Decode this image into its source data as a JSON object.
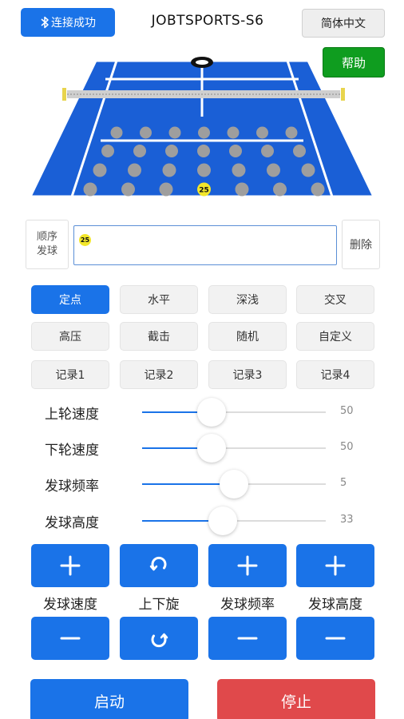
{
  "header": {
    "connect_label": "连接成功",
    "title": "JOBTSPORTS-S6",
    "language_label": "简体中文",
    "help_label": "帮助"
  },
  "court": {
    "selected_label": "25",
    "colors": {
      "court": "#1a5fd6",
      "lines": "#ffffff",
      "net": "#c8c8c8",
      "dots": "#9e9e9e",
      "selected": "#f2e62a"
    }
  },
  "sequence": {
    "label_line1": "顺序",
    "label_line2": "发球",
    "items": [
      "25"
    ],
    "delete_label": "删除"
  },
  "modes": [
    {
      "label": "定点",
      "active": true
    },
    {
      "label": "水平",
      "active": false
    },
    {
      "label": "深浅",
      "active": false
    },
    {
      "label": "交叉",
      "active": false
    },
    {
      "label": "高压",
      "active": false
    },
    {
      "label": "截击",
      "active": false
    },
    {
      "label": "随机",
      "active": false
    },
    {
      "label": "自定义",
      "active": false
    },
    {
      "label": "记录1",
      "active": false
    },
    {
      "label": "记录2",
      "active": false
    },
    {
      "label": "记录3",
      "active": false
    },
    {
      "label": "记录4",
      "active": false
    }
  ],
  "sliders": [
    {
      "label": "上轮速度",
      "value": "50",
      "level": 0.38
    },
    {
      "label": "下轮速度",
      "value": "50",
      "level": 0.38
    },
    {
      "label": "发球频率",
      "value": "5",
      "level": 0.5
    },
    {
      "label": "发球高度",
      "value": "33",
      "level": 0.44
    }
  ],
  "controls": [
    {
      "label": "发球速度",
      "up_icon": "plus-icon",
      "down_icon": "minus-icon"
    },
    {
      "label": "上下旋",
      "up_icon": "rotate-ccw-icon",
      "down_icon": "rotate-cw-icon"
    },
    {
      "label": "发球频率",
      "up_icon": "plus-icon",
      "down_icon": "minus-icon"
    },
    {
      "label": "发球高度",
      "up_icon": "plus-icon",
      "down_icon": "minus-icon"
    }
  ],
  "actions": {
    "start_label": "启动",
    "stop_label": "停止"
  }
}
